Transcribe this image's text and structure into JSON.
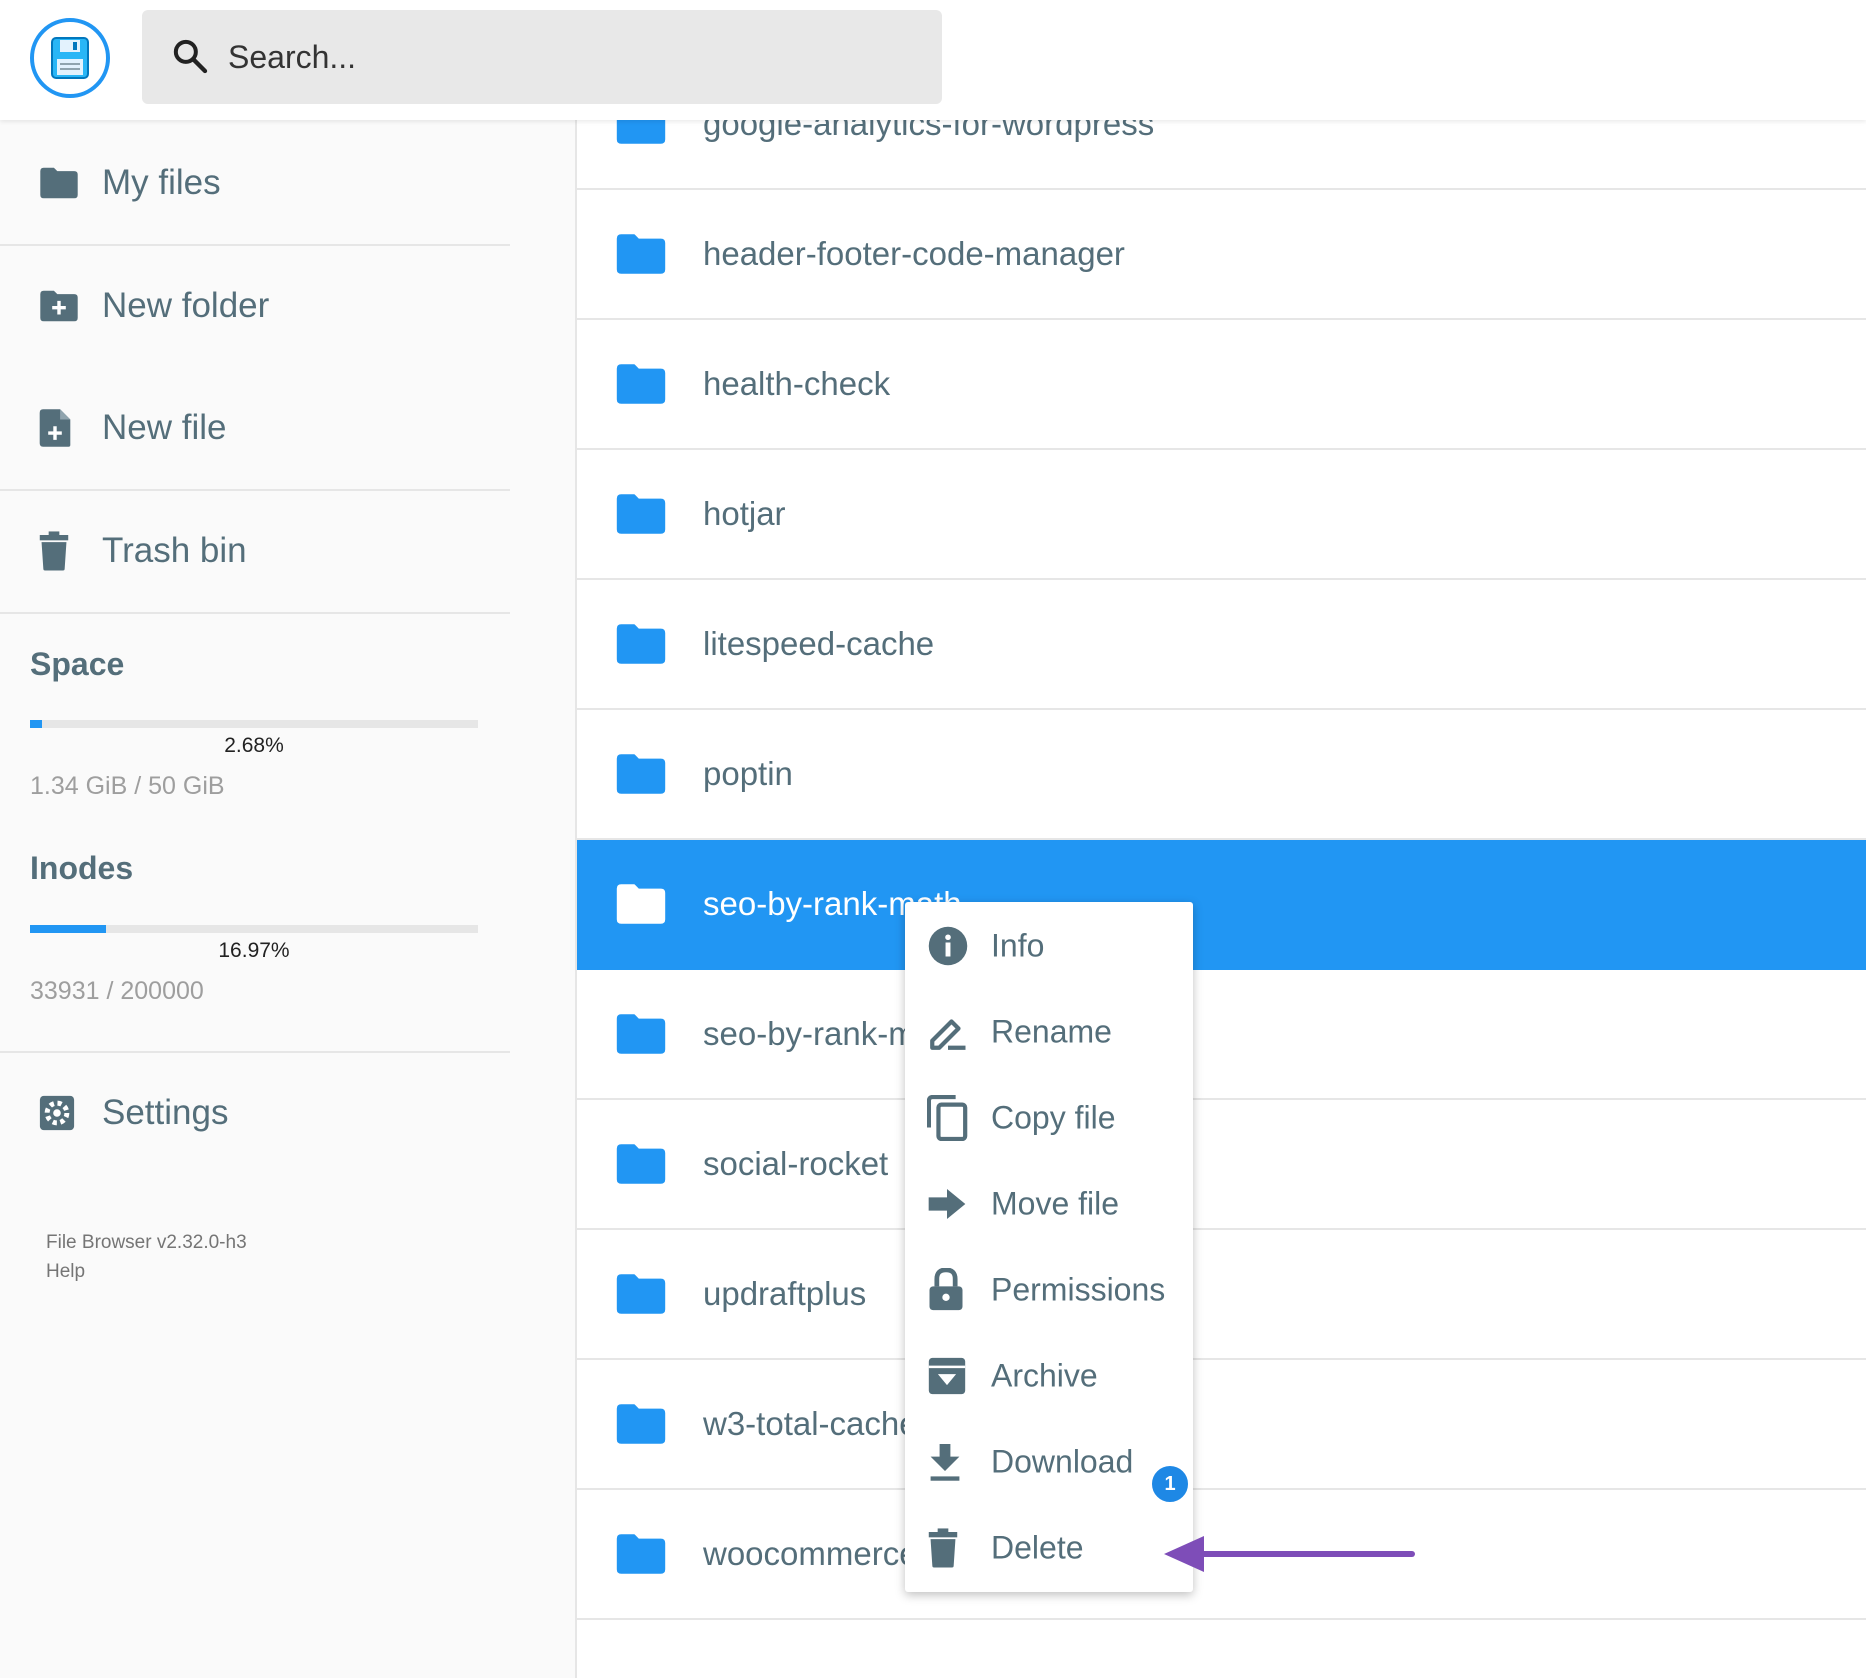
{
  "header": {
    "search_placeholder": "Search..."
  },
  "sidebar": {
    "items": [
      {
        "label": "My files",
        "icon": "folder-icon"
      },
      {
        "label": "New folder",
        "icon": "new-folder-icon"
      },
      {
        "label": "New file",
        "icon": "new-file-icon"
      },
      {
        "label": "Trash bin",
        "icon": "trash-icon"
      }
    ],
    "space": {
      "title": "Space",
      "percent_label": "2.68%",
      "percent": 2.68,
      "usage": "1.34 GiB / 50 GiB"
    },
    "inodes": {
      "title": "Inodes",
      "percent_label": "16.97%",
      "percent": 16.97,
      "usage": "33931 / 200000"
    },
    "settings_label": "Settings",
    "version": "File Browser v2.32.0-h3",
    "help": "Help"
  },
  "files": [
    {
      "name": "google-analytics-for-wordpress"
    },
    {
      "name": "header-footer-code-manager"
    },
    {
      "name": "health-check"
    },
    {
      "name": "hotjar"
    },
    {
      "name": "litespeed-cache"
    },
    {
      "name": "poptin"
    },
    {
      "name": "seo-by-rank-math",
      "selected": true
    },
    {
      "name": "seo-by-rank-math-pro"
    },
    {
      "name": "social-rocket"
    },
    {
      "name": "updraftplus"
    },
    {
      "name": "w3-total-cache"
    },
    {
      "name": "woocommerce"
    }
  ],
  "context_menu": {
    "items": [
      {
        "label": "Info",
        "icon": "info-icon"
      },
      {
        "label": "Rename",
        "icon": "rename-icon"
      },
      {
        "label": "Copy file",
        "icon": "copy-icon"
      },
      {
        "label": "Move file",
        "icon": "move-icon"
      },
      {
        "label": "Permissions",
        "icon": "lock-icon"
      },
      {
        "label": "Archive",
        "icon": "archive-icon"
      },
      {
        "label": "Download",
        "icon": "download-icon"
      },
      {
        "label": "Delete",
        "icon": "delete-icon"
      }
    ],
    "badge": "1"
  },
  "colors": {
    "accent": "#2196f3",
    "text": "#546e7a",
    "annotation_arrow": "#7e4db8"
  }
}
